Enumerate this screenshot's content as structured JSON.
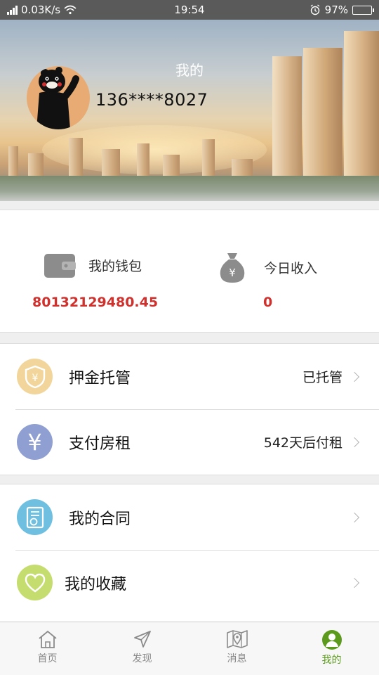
{
  "status_bar": {
    "network_speed": "0.03K/s",
    "time": "19:54",
    "battery": "97%",
    "battery_level": 0.97,
    "icons": [
      "signal-icon",
      "wifi-icon",
      "alarm-icon",
      "battery-icon"
    ]
  },
  "header": {
    "title": "我的",
    "phone": "136****8027"
  },
  "wallet": {
    "wallet_label": "我的钱包",
    "wallet_value": "80132129480.45",
    "income_label": "今日收入",
    "income_value": "0",
    "value_color": "#d0312d"
  },
  "menu_group_1": [
    {
      "label": "押金托管",
      "value": "已托管",
      "icon": "deposit-shield-icon",
      "color": "#f2d59a"
    },
    {
      "label": "支付房租",
      "value": "542天后付租",
      "icon": "yuan-icon",
      "color": "#8f9fd1"
    }
  ],
  "menu_group_2": [
    {
      "label": "我的合同",
      "icon": "contract-icon",
      "color": "#6fbfe0"
    },
    {
      "label": "我的收藏",
      "icon": "heart-icon",
      "color": "#c5dd6f"
    }
  ],
  "tab_bar": {
    "tabs": [
      {
        "label": "首页",
        "icon": "home-icon"
      },
      {
        "label": "发现",
        "icon": "send-icon"
      },
      {
        "label": "消息",
        "icon": "map-pin-icon"
      },
      {
        "label": "我的",
        "icon": "user-icon",
        "active": true
      }
    ],
    "active_color": "#5c9a1e"
  }
}
